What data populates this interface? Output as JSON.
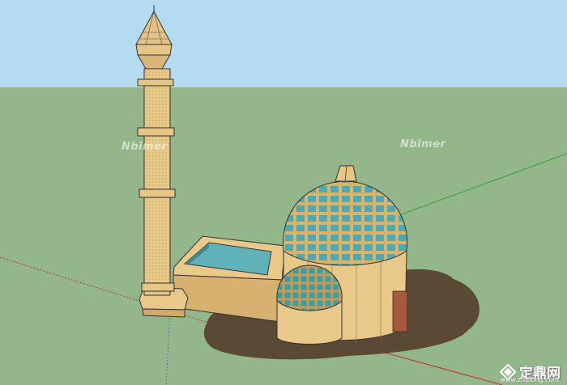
{
  "scene": {
    "sky_color": "#b4dbf0",
    "ground_color": "#93b78a",
    "wall_color": "#e8c98a",
    "shadow_color": "#5a4a35",
    "glass_color": "#5fb3b8"
  },
  "watermarks": {
    "left": "Nbimer",
    "right": "Nbimer"
  },
  "brand": {
    "logo_icon": "zhulong-logo-icon",
    "text": "定鼎网",
    "url": "www.zhulong.com"
  }
}
